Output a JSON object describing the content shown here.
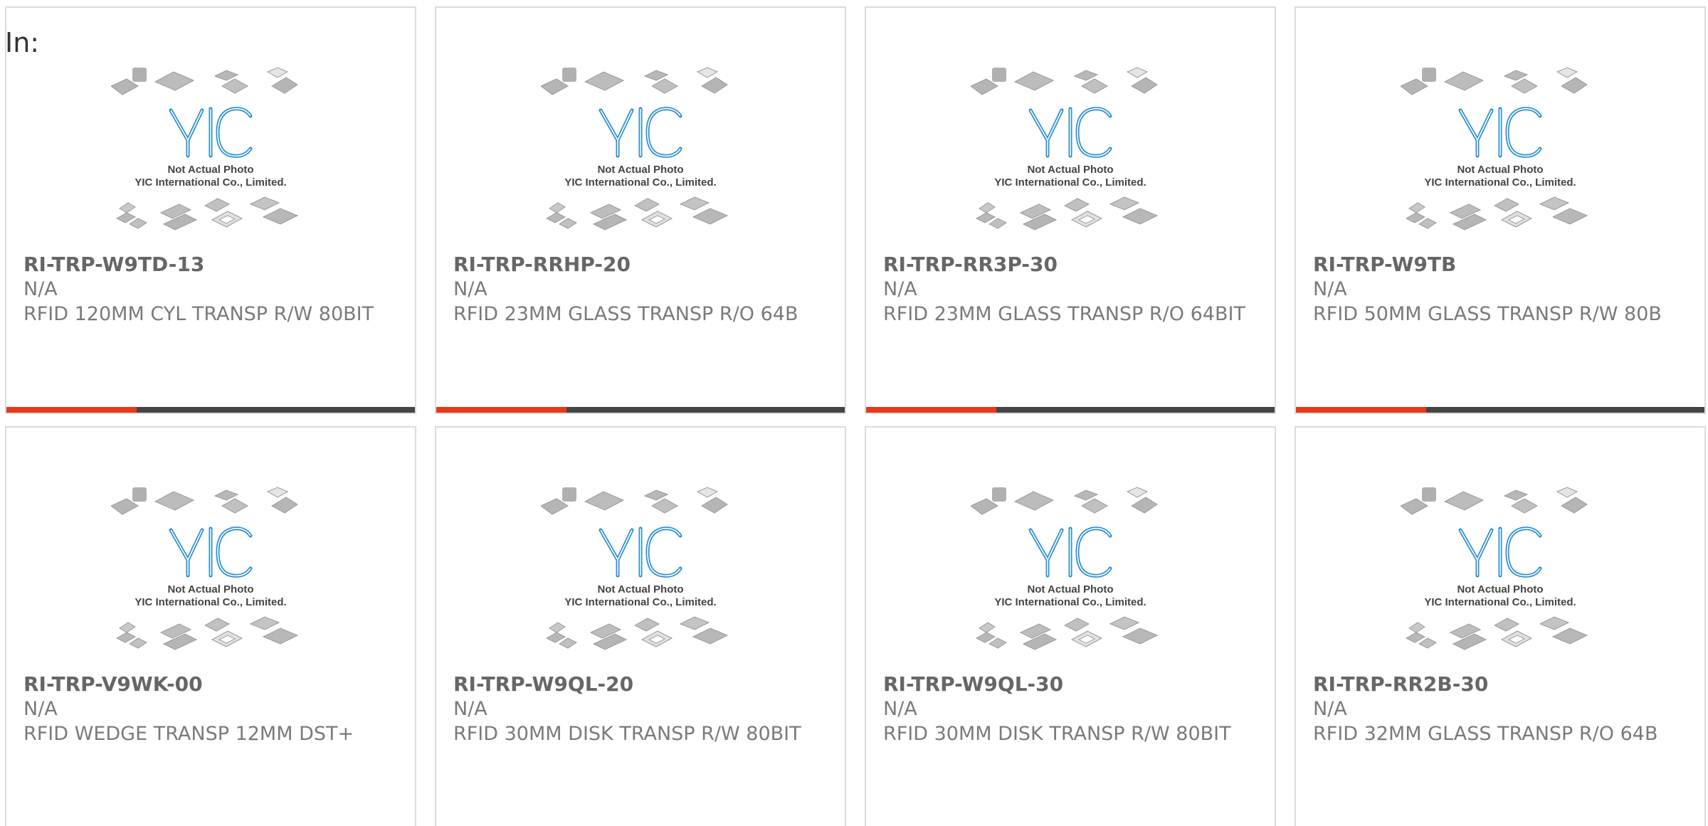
{
  "heading": "In:",
  "colors": {
    "accent": "#e8391a",
    "bar": "#444444",
    "logo": "#2a8fd0"
  },
  "placeholder": {
    "logo_text": "YIC",
    "line1": "Not Actual Photo",
    "line2": "YIC International Co., Limited."
  },
  "products": [
    {
      "part_number": "RI-TRP-W9TD-13",
      "manufacturer": "N/A",
      "description": "RFID 120MM CYL TRANSP R/W 80BIT"
    },
    {
      "part_number": "RI-TRP-RRHP-20",
      "manufacturer": "N/A",
      "description": "RFID 23MM GLASS TRANSP R/O 64B"
    },
    {
      "part_number": "RI-TRP-RR3P-30",
      "manufacturer": "N/A",
      "description": "RFID 23MM GLASS TRANSP R/O 64BIT"
    },
    {
      "part_number": "RI-TRP-W9TB",
      "manufacturer": "N/A",
      "description": "RFID 50MM GLASS TRANSP R/W 80B"
    },
    {
      "part_number": "RI-TRP-V9WK-00",
      "manufacturer": "N/A",
      "description": "RFID WEDGE TRANSP 12MM DST+"
    },
    {
      "part_number": "RI-TRP-W9QL-20",
      "manufacturer": "N/A",
      "description": "RFID 30MM DISK TRANSP R/W 80BIT"
    },
    {
      "part_number": "RI-TRP-W9QL-30",
      "manufacturer": "N/A",
      "description": "RFID 30MM DISK TRANSP R/W 80BIT"
    },
    {
      "part_number": "RI-TRP-RR2B-30",
      "manufacturer": "N/A",
      "description": "RFID 32MM GLASS TRANSP R/O 64B"
    }
  ]
}
